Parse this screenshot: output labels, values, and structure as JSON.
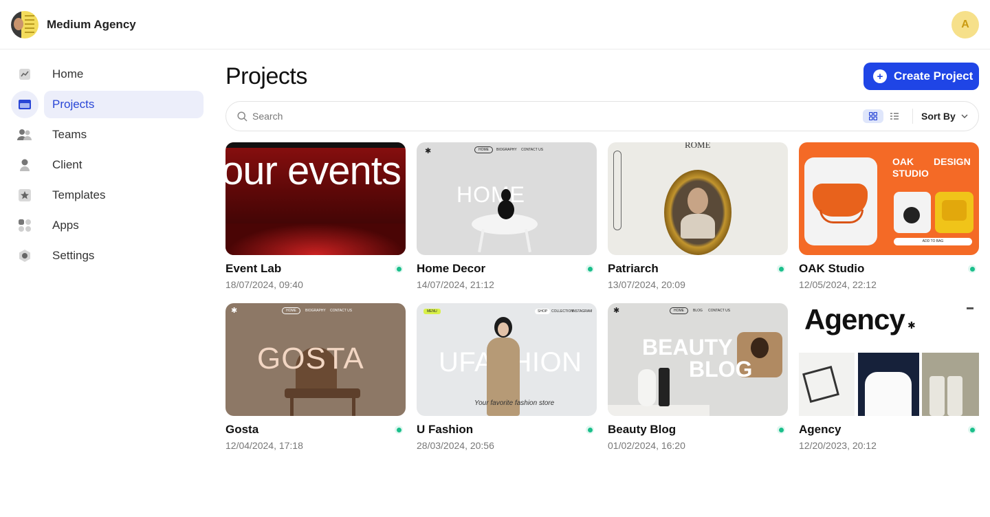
{
  "org": {
    "name": "Medium Agency"
  },
  "user": {
    "initial": "A"
  },
  "sidebar": {
    "items": [
      {
        "label": "Home",
        "icon": "chart-icon"
      },
      {
        "label": "Projects",
        "icon": "folder-icon",
        "active": true
      },
      {
        "label": "Teams",
        "icon": "team-icon"
      },
      {
        "label": "Client",
        "icon": "user-icon"
      },
      {
        "label": "Templates",
        "icon": "star-icon"
      },
      {
        "label": "Apps",
        "icon": "apps-icon"
      },
      {
        "label": "Settings",
        "icon": "gear-icon"
      }
    ]
  },
  "main": {
    "title": "Projects",
    "create_label": "Create Project",
    "search_placeholder": "Search",
    "sort_label": "Sort By"
  },
  "colors": {
    "accent": "#1f45e6",
    "status": "#1bbf8b",
    "active_bg": "#eceefa"
  },
  "projects": [
    {
      "name": "Event Lab",
      "date": "18/07/2024, 09:40",
      "thumb_text": "our events"
    },
    {
      "name": "Home Decor",
      "date": "14/07/2024, 21:12",
      "thumb_text": "HOME",
      "nav": [
        "HOME",
        "BIOGRAPHY",
        "CONTACT US"
      ]
    },
    {
      "name": "Patriarch",
      "date": "13/07/2024, 20:09",
      "thumb_text": "ROME"
    },
    {
      "name": "OAK Studio",
      "date": "12/05/2024, 22:12",
      "thumb_text": "OAK STUDIO",
      "thumb_text2": "DESIGN",
      "thumb_button": "ADD TO BAG"
    },
    {
      "name": "Gosta",
      "date": "12/04/2024, 17:18",
      "thumb_text": "GOSTA",
      "nav": [
        "HOME",
        "BIOGRAPHY",
        "CONTACT US"
      ]
    },
    {
      "name": "U Fashion",
      "date": "28/03/2024, 20:56",
      "thumb_text": "UFASHION",
      "thumb_sub": "Your favorite fashion store",
      "nav": [
        "SHOP",
        "COLLECTION",
        "INSTAGRAM"
      ],
      "badge": "MENU"
    },
    {
      "name": "Beauty Blog",
      "date": "01/02/2024, 16:20",
      "thumb_text": "BEAUTY",
      "thumb_text2": "BLOG",
      "nav": [
        "HOME",
        "BLOG",
        "CONTACT US"
      ]
    },
    {
      "name": "Agency",
      "date": "12/20/2023, 20:12",
      "thumb_text": "Agency"
    }
  ]
}
